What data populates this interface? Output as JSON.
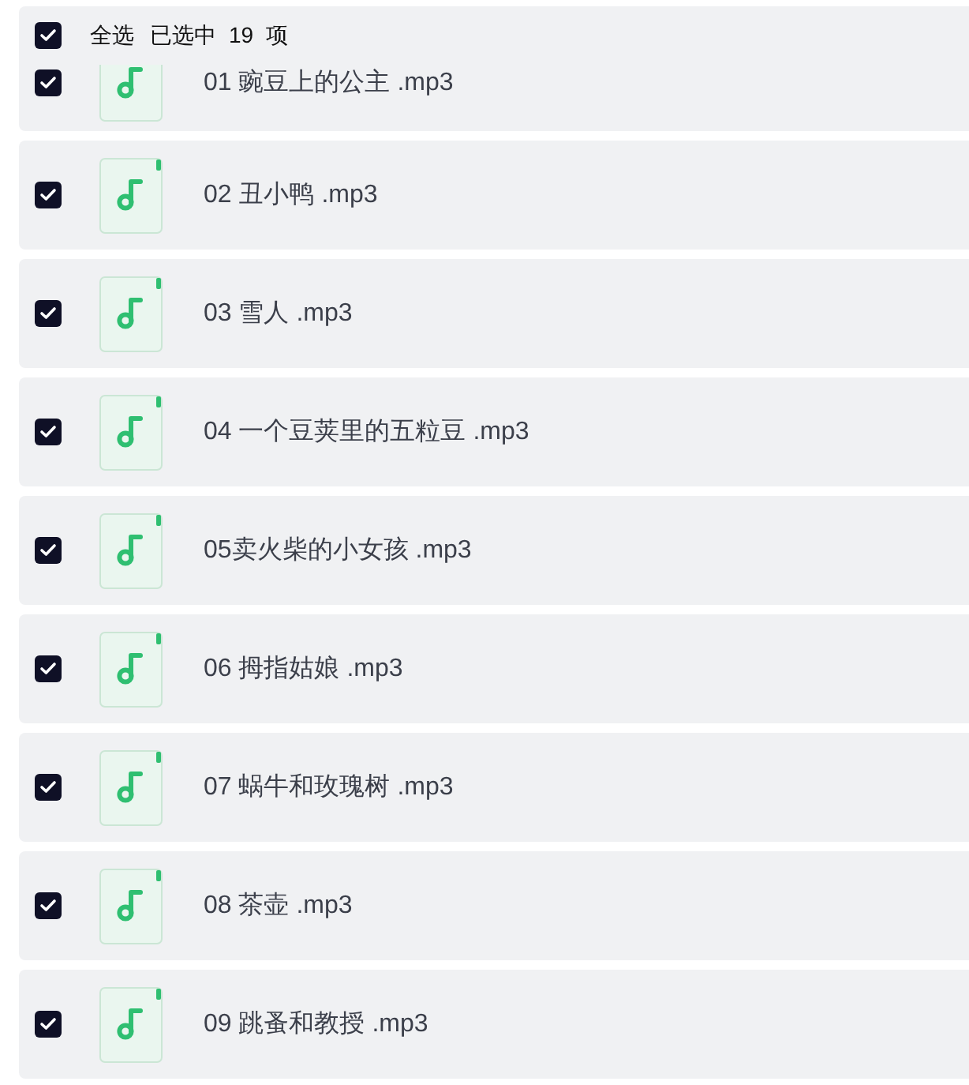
{
  "header": {
    "checked": true,
    "select_all": "全选",
    "selected_label": "已选中",
    "count": "19",
    "unit": "项"
  },
  "files": [
    {
      "name": "01 豌豆上的公主 .mp3",
      "checked": true
    },
    {
      "name": "02 丑小鸭 .mp3",
      "checked": true
    },
    {
      "name": "03 雪人 .mp3",
      "checked": true
    },
    {
      "name": "04 一个豆荚里的五粒豆 .mp3",
      "checked": true
    },
    {
      "name": "05卖火柴的小女孩 .mp3",
      "checked": true
    },
    {
      "name": "06 拇指姑娘 .mp3",
      "checked": true
    },
    {
      "name": "07 蜗牛和玫瑰树 .mp3",
      "checked": true
    },
    {
      "name": "08 茶壶 .mp3",
      "checked": true
    },
    {
      "name": "09 跳蚤和教授 .mp3",
      "checked": true
    }
  ]
}
